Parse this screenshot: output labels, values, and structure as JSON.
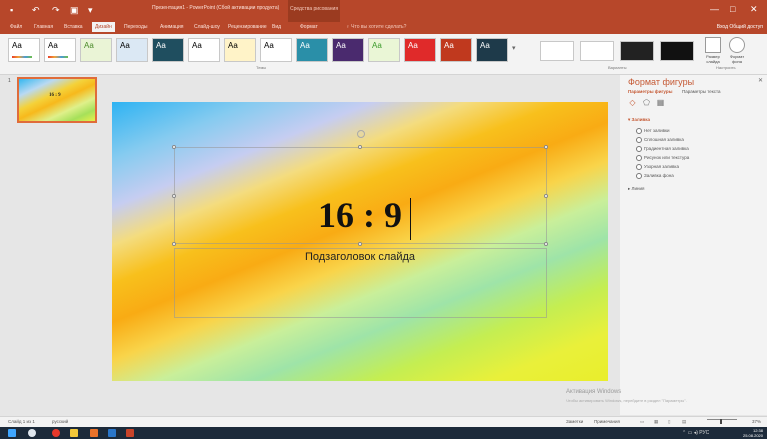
{
  "titlebar": {
    "title": "Презентация1 - PowerPoint (Сбой активации продукта)",
    "context_tab_header": "Средства рисования",
    "window_buttons": [
      "—",
      "□",
      "✕"
    ]
  },
  "tabs": [
    {
      "label": "Файл"
    },
    {
      "label": "Главная"
    },
    {
      "label": "Вставка"
    },
    {
      "label": "Дизайн"
    },
    {
      "label": "Переходы"
    },
    {
      "label": "Анимация"
    },
    {
      "label": "Слайд-шоу"
    },
    {
      "label": "Рецензирование"
    },
    {
      "label": "Вид"
    },
    {
      "label": "Формат"
    }
  ],
  "active_tab": "Дизайн",
  "tell_me": "Что вы хотите сделать?",
  "share": "Вход  Общий доступ",
  "ribbon": {
    "theme_sample": "Aa",
    "group_themes": "Темы",
    "group_variants": "Варианты",
    "group_customize": "Настроить",
    "btn_slide_size": "Размер слайда",
    "btn_format_bg": "Формат фона"
  },
  "thumbnail": {
    "number": "1",
    "title": "16 : 9"
  },
  "slide": {
    "title": "16 : 9",
    "subtitle": "Подзаголовок слайда"
  },
  "format_pane": {
    "title": "Формат фигуры",
    "tab_shape": "Параметры фигуры",
    "tab_text": "Параметры текста",
    "section_fill": "Заливка",
    "fill_options": [
      "Нет заливки",
      "Сплошная заливка",
      "Градиентная заливка",
      "Рисунок или текстура",
      "Узорная заливка",
      "Заливка фона"
    ],
    "section_line": "Линия"
  },
  "watermark": {
    "line1": "Активация Windows",
    "line2": "Чтобы активировать Windows, перейдите в раздел \"Параметры\"."
  },
  "statusbar": {
    "slide_counter": "Слайд 1 из 1",
    "language": "русский",
    "notes": "Заметки",
    "comments": "Примечания",
    "zoom": "37%"
  },
  "taskbar": {
    "tray": "РУС",
    "time": "12:38",
    "date": "25.08.2020"
  }
}
